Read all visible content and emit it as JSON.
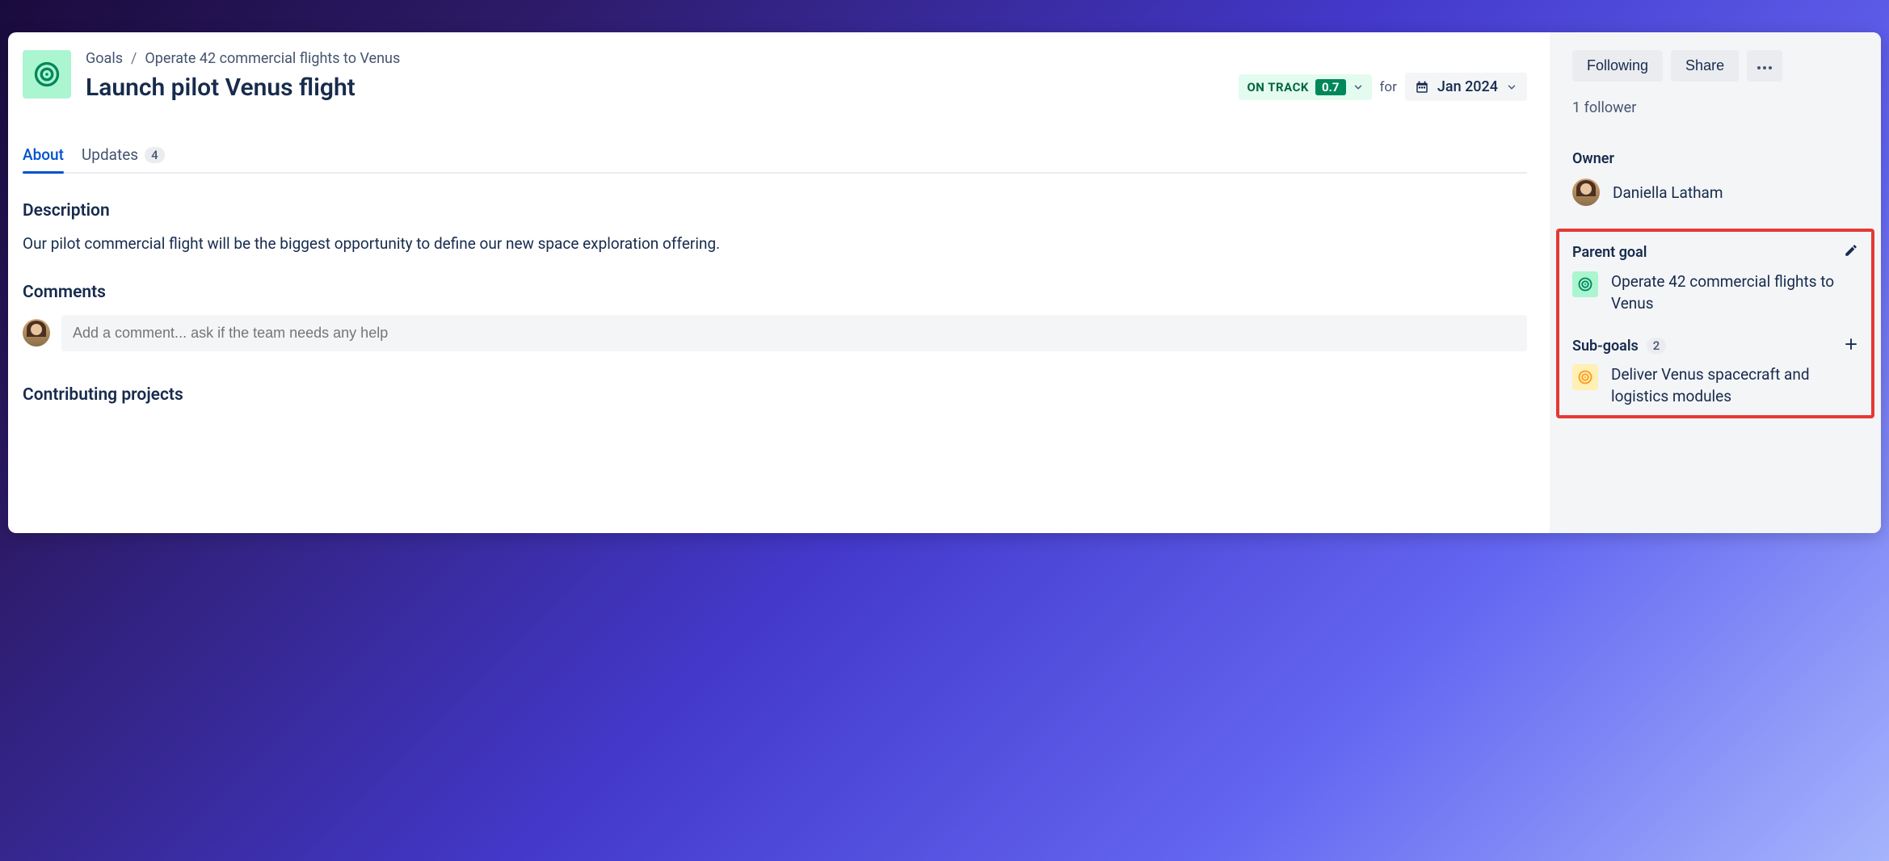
{
  "breadcrumb": {
    "root": "Goals",
    "parent": "Operate 42 commercial flights to Venus"
  },
  "title": "Launch pilot Venus flight",
  "status": {
    "label": "ON TRACK",
    "score": "0.7"
  },
  "for_label": "for",
  "target_date": "Jan 2024",
  "tabs": {
    "about": "About",
    "updates": "Updates",
    "updates_count": "4"
  },
  "sections": {
    "description_label": "Description",
    "description_text": "Our pilot commercial flight will be the biggest opportunity to define our new space exploration offering.",
    "comments_label": "Comments",
    "comment_placeholder": "Add a comment... ask if the team needs any help",
    "contributing_label": "Contributing projects"
  },
  "sidebar": {
    "following": "Following",
    "share": "Share",
    "followers": "1 follower",
    "owner_label": "Owner",
    "owner_name": "Daniella Latham",
    "parent_goal_label": "Parent goal",
    "parent_goal_name": "Operate 42 commercial flights to Venus",
    "subgoals_label": "Sub-goals",
    "subgoals_count": "2",
    "subgoal_1": "Deliver Venus spacecraft and logistics modules"
  }
}
